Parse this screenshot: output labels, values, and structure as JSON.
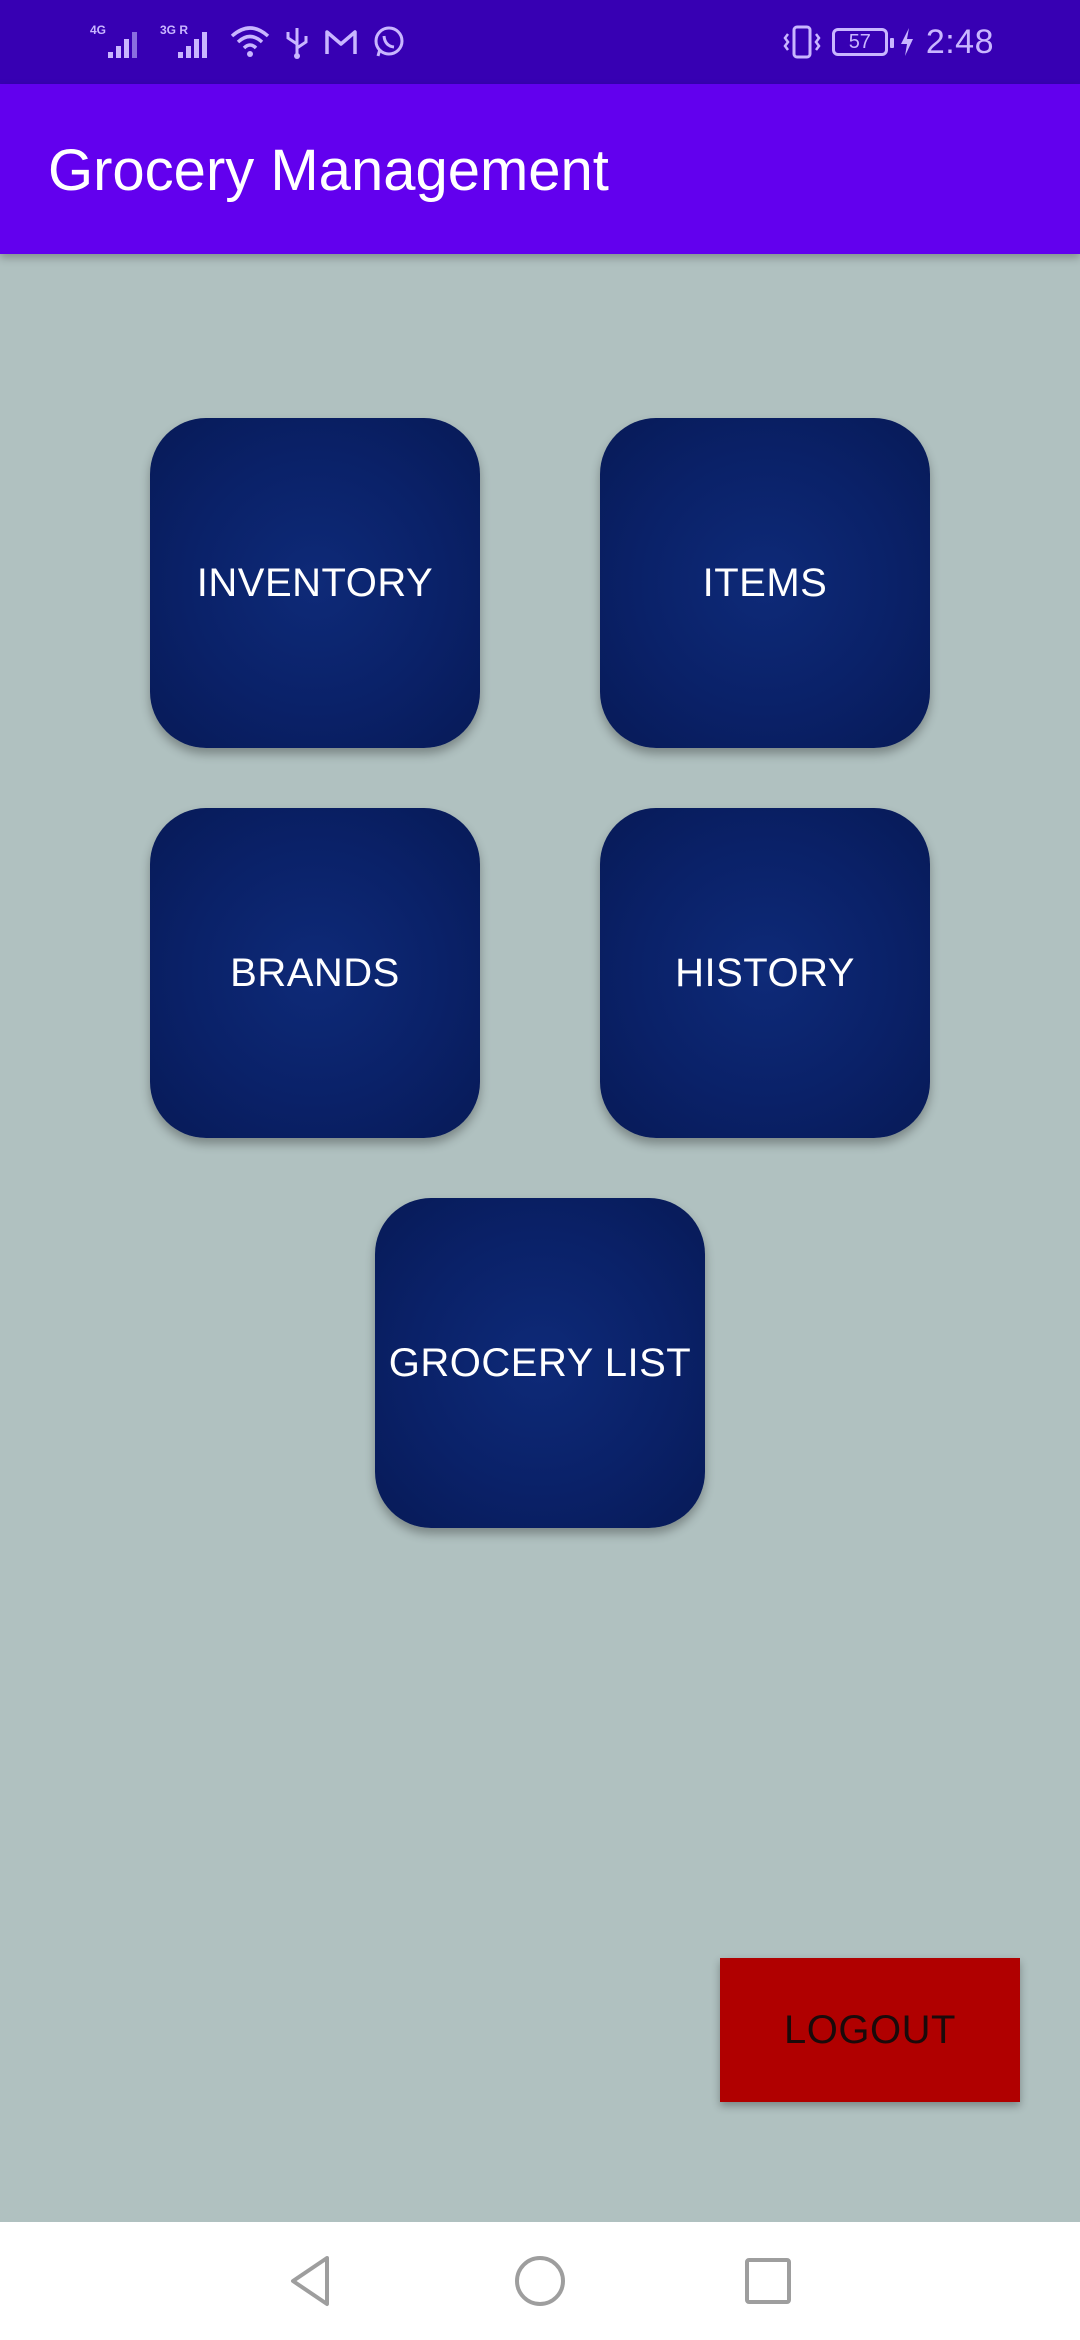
{
  "status_bar": {
    "network_1": "4G",
    "network_2": "3G R",
    "battery_level": "57",
    "time": "2:48",
    "icons": [
      "signal-4g-icon",
      "signal-3g-icon",
      "wifi-icon",
      "usb-icon",
      "gmail-icon",
      "whatsapp-icon",
      "vibrate-icon",
      "battery-icon",
      "charging-icon"
    ]
  },
  "app_bar": {
    "title": "Grocery Management"
  },
  "tiles": {
    "inventory": "INVENTORY",
    "items": "ITEMS",
    "brands": "BRANDS",
    "history": "HISTORY",
    "grocery_list": "GROCERY LIST"
  },
  "logout": {
    "label": "LOGOUT"
  },
  "nav_bar": {
    "icons": [
      "back-icon",
      "home-icon",
      "recents-icon"
    ]
  },
  "colors": {
    "status_bar": "#3700b3",
    "app_bar": "#6200ee",
    "background": "#b0c1c0",
    "tile": "#0a2168",
    "logout": "#b00000",
    "nav_bar": "#ffffff"
  }
}
